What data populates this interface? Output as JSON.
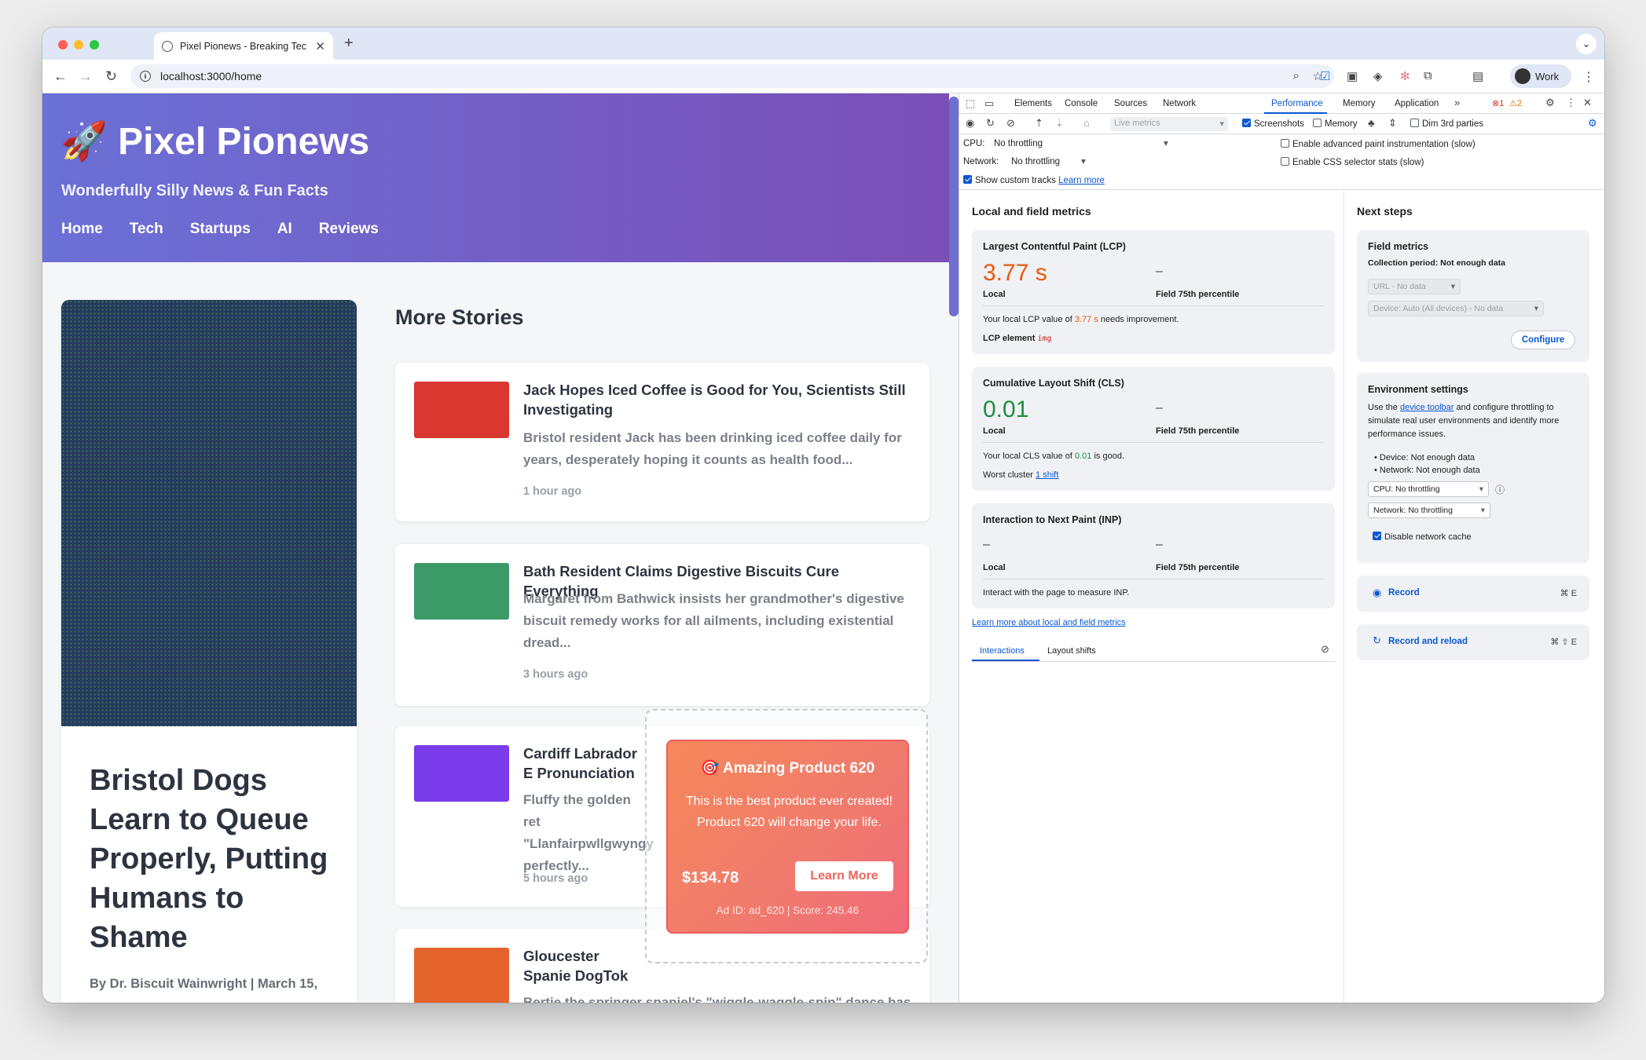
{
  "browser": {
    "tab_title": "Pixel Pionews - Breaking Tec",
    "url": "localhost:3000/home",
    "profile_label": "Work"
  },
  "site": {
    "title": "🚀 Pixel Pionews",
    "tagline": "Wonderfully Silly News & Fun Facts",
    "nav": [
      "Home",
      "Tech",
      "Startups",
      "AI",
      "Reviews"
    ],
    "lead": {
      "title": "Bristol Dogs Learn to Queue Properly, Putting Humans to Shame",
      "byline": "By Dr. Biscuit Wainwright | March 15,"
    },
    "more_stories_heading": "More Stories",
    "stories": [
      {
        "title": "Jack Hopes Iced Coffee is Good for You, Scientists Still Investigating",
        "excerpt": "Bristol resident Jack has been drinking iced coffee daily for years, desperately hoping it counts as health food...",
        "time": "1 hour ago",
        "color": "#d9372f"
      },
      {
        "title": "Bath Resident Claims Digestive Biscuits Cure Everything",
        "excerpt": "Margaret from Bathwick insists her grandmother's digestive biscuit remedy works for all ailments, including existential dread...",
        "time": "3 hours ago",
        "color": "#3c9a68"
      },
      {
        "title": "Cardiff Labrador E Pronunciation",
        "excerpt": "Fluffy the golden ret \"Llanfairpwllgwyngy perfectly...",
        "time": "5 hours ago",
        "color": "#7a3bea"
      },
      {
        "title": "Gloucester Spanie DogTok",
        "excerpt": "Bertie the springer spaniel's \"wiggle-waggle-spin\" dance has",
        "time": "",
        "color": "#e4632a"
      }
    ],
    "ad": {
      "title": "🎯 Amazing Product 620",
      "description": "This is the best product ever created! Product 620 will change your life.",
      "price": "$134.78",
      "button": "Learn More",
      "meta": "Ad ID: ad_620 | Score: 245.46"
    }
  },
  "devtools": {
    "tabs": [
      "Elements",
      "Console",
      "Sources",
      "Network",
      "Performance",
      "Memory",
      "Application"
    ],
    "active_tab": "Performance",
    "errors": "1",
    "warnings": "2",
    "toolbar": {
      "live_metrics": "Live metrics",
      "screenshots": "Screenshots",
      "memory": "Memory",
      "dim_3rd_parties": "Dim 3rd parties"
    },
    "settings": {
      "cpu_label": "CPU:",
      "cpu_value": "No throttling",
      "network_label": "Network:",
      "network_value": "No throttling",
      "show_custom_tracks": "Show custom tracks",
      "learn_more": "Learn more",
      "adv_paint": "Enable advanced paint instrumentation (slow)",
      "css_selector": "Enable CSS selector stats (slow)"
    },
    "metrics": {
      "heading": "Local and field metrics",
      "lcp": {
        "title": "Largest Contentful Paint (LCP)",
        "value": "3.77 s",
        "local": "Local",
        "field_dash": "–",
        "field_label": "Field 75th percentile",
        "desc_pre": "Your local LCP value of ",
        "desc_val": "3.77 s",
        "desc_post": " needs improvement.",
        "element_label": "LCP element",
        "element_value": "img",
        "color": "#e8590c"
      },
      "cls": {
        "title": "Cumulative Layout Shift (CLS)",
        "value": "0.01",
        "local": "Local",
        "field_dash": "–",
        "field_label": "Field 75th percentile",
        "desc_pre": "Your local CLS value of ",
        "desc_val": "0.01",
        "desc_post": " is good.",
        "cluster_label": "Worst cluster",
        "cluster_link": "1 shift",
        "color": "#1e8e3e"
      },
      "inp": {
        "title": "Interaction to Next Paint (INP)",
        "value": "–",
        "local": "Local",
        "field_dash": "–",
        "field_label": "Field 75th percentile",
        "desc": "Interact with the page to measure INP."
      },
      "learn_more_link": "Learn more about local and field metrics",
      "subtabs": [
        "Interactions",
        "Layout shifts"
      ]
    },
    "next_steps": {
      "heading": "Next steps",
      "field_metrics": {
        "title": "Field metrics",
        "period": "Collection period: Not enough data",
        "url_select": "URL - No data",
        "device_select": "Device: Auto (All devices) - No data",
        "configure": "Configure"
      },
      "environment": {
        "title": "Environment settings",
        "desc_pre": "Use the ",
        "desc_link": "device toolbar",
        "desc_post": " and configure throttling to simulate real user environments and identify more performance issues.",
        "bullets": [
          "Device: Not enough data",
          "Network: Not enough data"
        ],
        "cpu_select": "CPU: No throttling",
        "network_select": "Network: No throttling",
        "disable_cache": "Disable network cache"
      },
      "record": {
        "label": "Record",
        "shortcut": "⌘ E"
      },
      "record_reload": {
        "label": "Record and reload",
        "shortcut": "⌘ ⇧ E"
      }
    }
  }
}
